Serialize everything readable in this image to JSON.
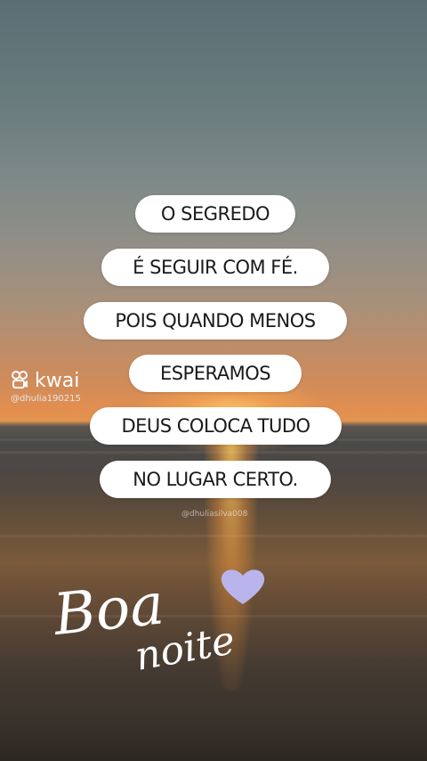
{
  "watermark": {
    "brand": "kwai",
    "username": "@dhulia190215",
    "overlay_username": "@dhuliasilva008"
  },
  "phrases": [
    "O SEGREDO",
    "É SEGUIR COM FÉ.",
    "POIS QUANDO MENOS",
    "ESPERAMOS",
    "DEUS COLOCA TUDO",
    "NO LUGAR CERTO."
  ],
  "greeting": {
    "line1": "Boa",
    "line2": "noite",
    "heart_color": "#b9b4ec"
  },
  "colors": {
    "pill_bg": "#ffffff",
    "pill_text": "#1a1a1a",
    "script_text": "#ffffff"
  }
}
